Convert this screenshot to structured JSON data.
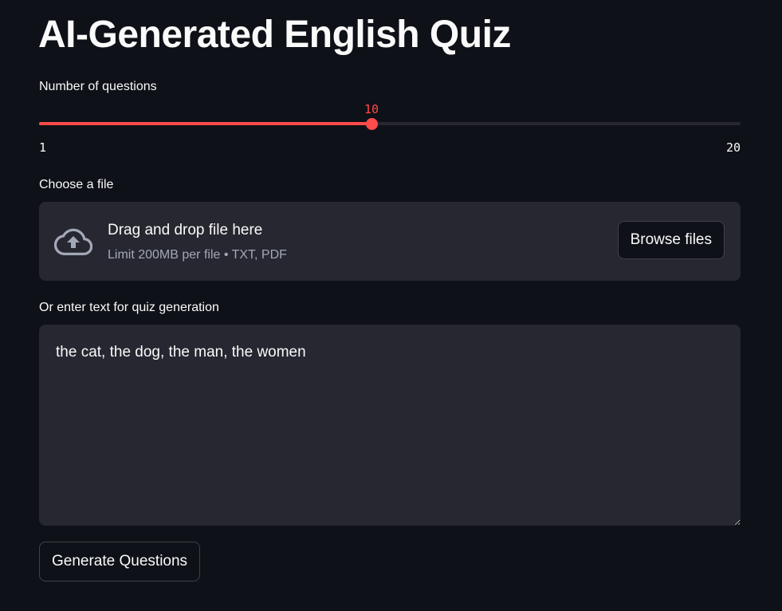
{
  "page": {
    "title": "AI-Generated English Quiz"
  },
  "slider": {
    "label": "Number of questions",
    "value": 10,
    "value_text": "10",
    "min": 1,
    "max": 20,
    "min_text": "1",
    "max_text": "20",
    "accent_color": "#ff4b4b"
  },
  "uploader": {
    "label": "Choose a file",
    "title": "Drag and drop file here",
    "subtitle": "Limit 200MB per file • TXT, PDF",
    "browse_label": "Browse files",
    "icon": "cloud-upload-icon"
  },
  "text_input": {
    "label": "Or enter text for quiz generation",
    "value": "the cat, the dog, the man, the women"
  },
  "generate_label": "Generate Questions",
  "colors": {
    "background": "#0e1117",
    "surface": "#262730",
    "text": "#fafafa",
    "muted": "#a3a8b8"
  }
}
